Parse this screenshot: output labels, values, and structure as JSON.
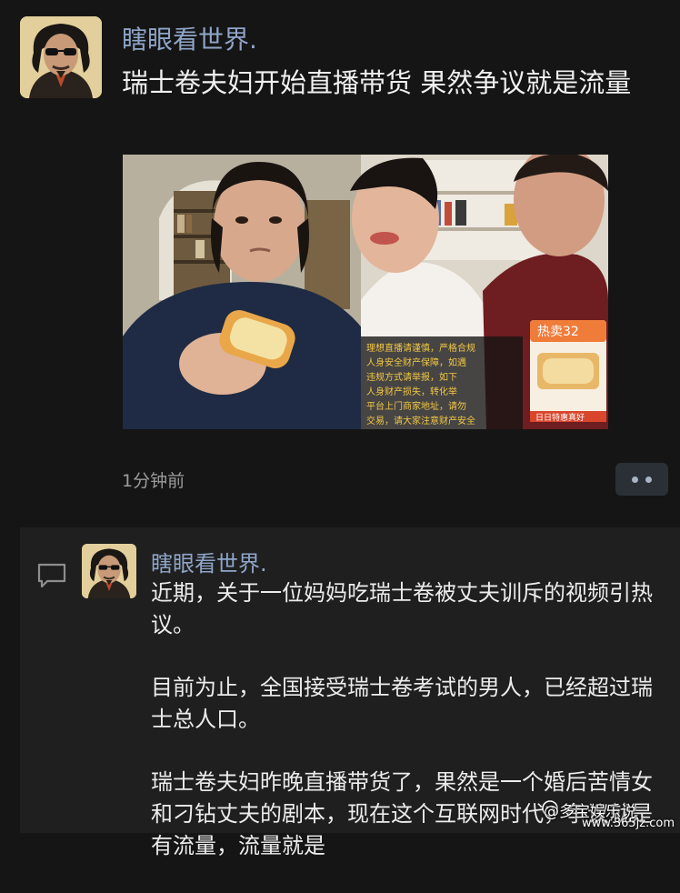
{
  "post": {
    "username": "瞎眼看世界.",
    "text": "瑞士卷夫妇开始直播带货 果然争议就是流量",
    "time": "1分钟前",
    "avatar_icon": "portrait-avatar-icon",
    "media": {
      "badge_text": "热卖32",
      "bottom_tag": "日日特惠真好",
      "overlay_lines": [
        "理想直播请谨慎，严格合规",
        "人身安全财产保障，如遇",
        "违规方式请举报，如下",
        "人身财产损失，转化举",
        "平台上门商家地址，请勿",
        "交易，请大家注意财产安全"
      ]
    }
  },
  "comment": {
    "username": "瞎眼看世界.",
    "paragraphs": [
      "近期，关于一位妈妈吃瑞士卷被丈夫训斥的视频引热议。",
      "目前为止，全国接受瑞士卷考试的男人，已经超过瑞士总人口。",
      "瑞士卷夫妇昨晚直播带货了，果然是一个婚后苦情女和刁钻丈夫的剧本，现在这个互联网时代，争议就是有流量，流量就是"
    ]
  },
  "watermark": {
    "label": "@多宝娱乐说",
    "url": "www.365jz.com"
  },
  "colors": {
    "background": "#151515",
    "name": "#8fa5c8",
    "comment_bg": "#1f1f1f"
  }
}
